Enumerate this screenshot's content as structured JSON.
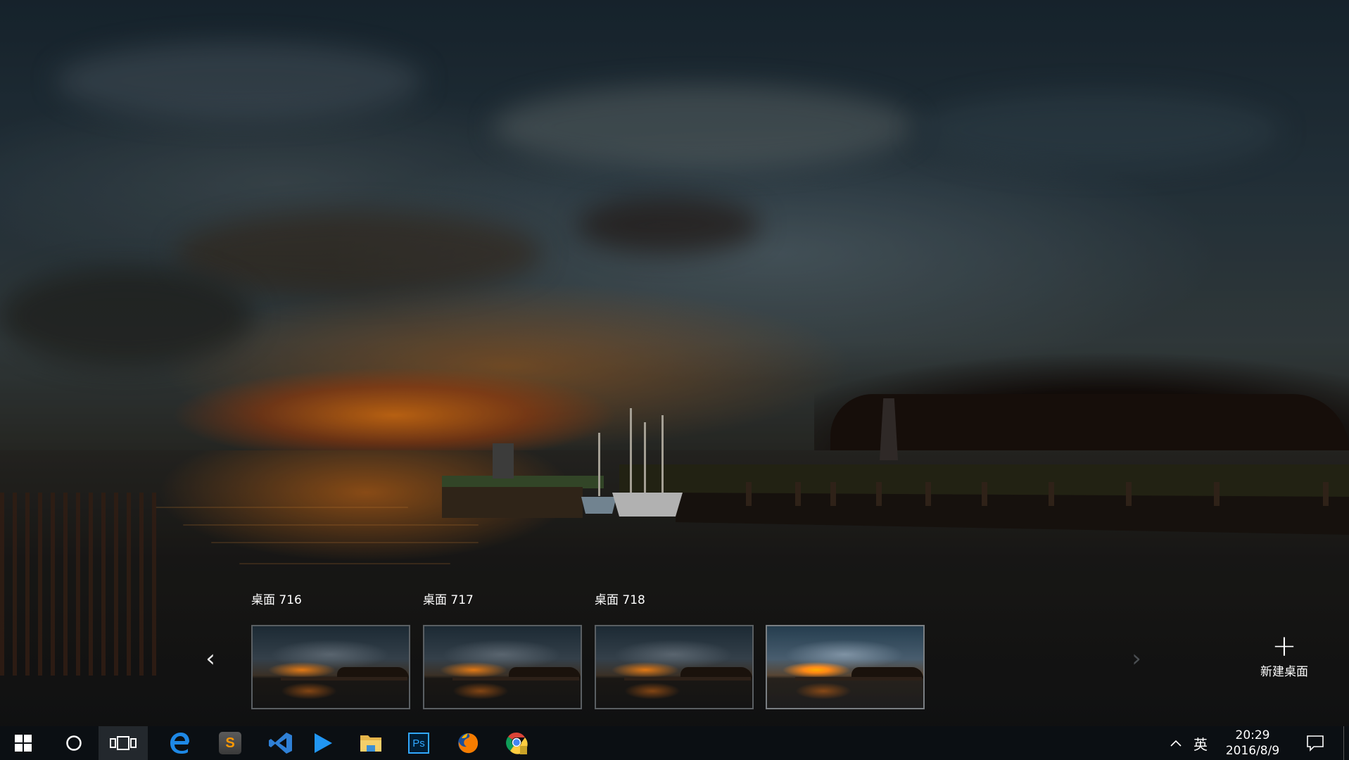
{
  "taskview": {
    "desktops": [
      {
        "label": "桌面 716",
        "active": false
      },
      {
        "label": "桌面 717",
        "active": false
      },
      {
        "label": "桌面 718",
        "active": false
      },
      {
        "label": "",
        "active": true
      }
    ],
    "prev_arrow": "‹",
    "next_arrow": "›",
    "new_desktop_icon": "+",
    "new_desktop_label": "新建桌面"
  },
  "taskbar": {
    "apps": [
      {
        "name": "edge-icon"
      },
      {
        "name": "sublime-text-icon",
        "glyph": "S"
      },
      {
        "name": "visual-studio-code-icon"
      },
      {
        "name": "media-player-icon"
      },
      {
        "name": "file-explorer-icon"
      },
      {
        "name": "photoshop-icon",
        "glyph": "Ps"
      },
      {
        "name": "firefox-icon"
      },
      {
        "name": "chrome-icon"
      }
    ],
    "tray": {
      "chevron": "^",
      "ime": "英",
      "time": "20:29",
      "date": "2016/8/9"
    }
  },
  "colors": {
    "taskbar": "#0b0f13",
    "edge": "#1e88e5",
    "vscode": "#2f80d6",
    "photoshop": "#31a8ff",
    "sublime": "#ff9800"
  }
}
